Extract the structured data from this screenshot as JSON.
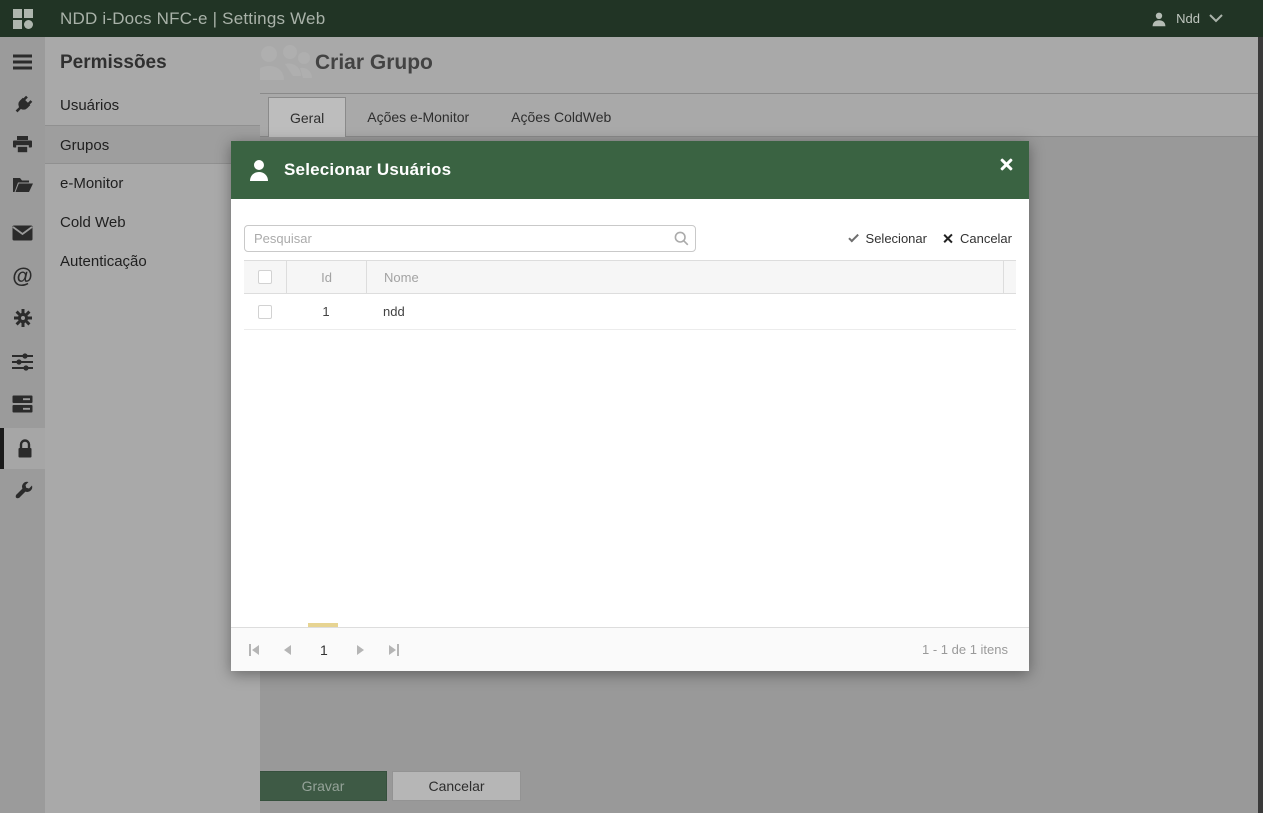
{
  "colors": {
    "topbar_green": "#213425",
    "modal_header_green": "#3a6342",
    "save_button_green": "#3e5a45",
    "dimmed_background_gray": "#999999",
    "page_indicator_yellow": "#e7d492"
  },
  "topbar": {
    "title": "NDD i-Docs NFC-e | Settings Web",
    "user": "Ndd"
  },
  "icon_rail": {
    "items": [
      "menu",
      "plug",
      "printer",
      "folder-open",
      "mail",
      "at-sign",
      "gear",
      "sliders",
      "server",
      "lock",
      "wrench"
    ],
    "selected": "lock"
  },
  "panel": {
    "title": "Permissões",
    "items": [
      "Usuários",
      "Grupos",
      "e-Monitor",
      "Cold Web",
      "Autenticação"
    ],
    "selected": "Grupos"
  },
  "main": {
    "title": "Criar Grupo",
    "tabs": [
      "Geral",
      "Ações e-Monitor",
      "Ações ColdWeb"
    ],
    "active_tab": "Geral",
    "save_label": "Gravar",
    "cancel_label": "Cancelar"
  },
  "modal": {
    "title": "Selecionar Usuários",
    "search_placeholder": "Pesquisar",
    "select_label": "Selecionar",
    "cancel_label": "Cancelar",
    "table": {
      "columns": [
        "Id",
        "Nome"
      ],
      "rows": [
        {
          "id": "1",
          "name": "ndd"
        }
      ]
    },
    "pager": {
      "page": "1",
      "info": "1 - 1 de 1 itens"
    }
  },
  "icons": {
    "check_icon": "css-check-shape",
    "cancel_x_icon": "css-x-shape",
    "close_icon": "css-x-shape",
    "search_icon": "magnifier",
    "user_icon": "person-silhouette",
    "chevron_down_icon": "chevron-down",
    "app_logo_icon": "four-tiles"
  }
}
